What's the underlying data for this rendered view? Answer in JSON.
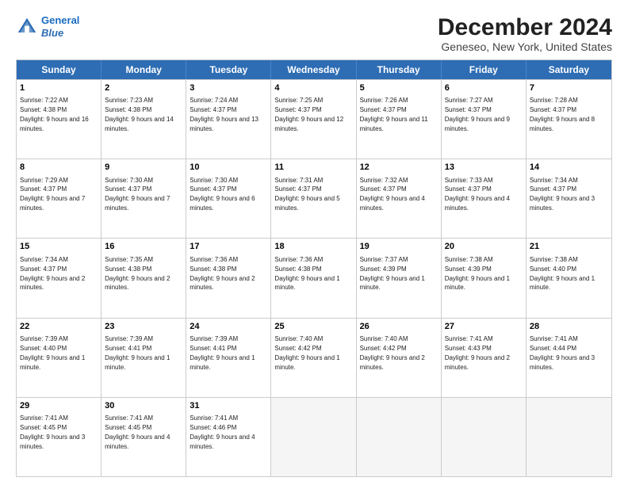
{
  "header": {
    "logo_line1": "General",
    "logo_line2": "Blue",
    "title": "December 2024",
    "subtitle": "Geneseo, New York, United States"
  },
  "weekdays": [
    "Sunday",
    "Monday",
    "Tuesday",
    "Wednesday",
    "Thursday",
    "Friday",
    "Saturday"
  ],
  "weeks": [
    [
      {
        "day": "1",
        "text": "Sunrise: 7:22 AM\nSunset: 4:38 PM\nDaylight: 9 hours and 16 minutes."
      },
      {
        "day": "2",
        "text": "Sunrise: 7:23 AM\nSunset: 4:38 PM\nDaylight: 9 hours and 14 minutes."
      },
      {
        "day": "3",
        "text": "Sunrise: 7:24 AM\nSunset: 4:37 PM\nDaylight: 9 hours and 13 minutes."
      },
      {
        "day": "4",
        "text": "Sunrise: 7:25 AM\nSunset: 4:37 PM\nDaylight: 9 hours and 12 minutes."
      },
      {
        "day": "5",
        "text": "Sunrise: 7:26 AM\nSunset: 4:37 PM\nDaylight: 9 hours and 11 minutes."
      },
      {
        "day": "6",
        "text": "Sunrise: 7:27 AM\nSunset: 4:37 PM\nDaylight: 9 hours and 9 minutes."
      },
      {
        "day": "7",
        "text": "Sunrise: 7:28 AM\nSunset: 4:37 PM\nDaylight: 9 hours and 8 minutes."
      }
    ],
    [
      {
        "day": "8",
        "text": "Sunrise: 7:29 AM\nSunset: 4:37 PM\nDaylight: 9 hours and 7 minutes."
      },
      {
        "day": "9",
        "text": "Sunrise: 7:30 AM\nSunset: 4:37 PM\nDaylight: 9 hours and 7 minutes."
      },
      {
        "day": "10",
        "text": "Sunrise: 7:30 AM\nSunset: 4:37 PM\nDaylight: 9 hours and 6 minutes."
      },
      {
        "day": "11",
        "text": "Sunrise: 7:31 AM\nSunset: 4:37 PM\nDaylight: 9 hours and 5 minutes."
      },
      {
        "day": "12",
        "text": "Sunrise: 7:32 AM\nSunset: 4:37 PM\nDaylight: 9 hours and 4 minutes."
      },
      {
        "day": "13",
        "text": "Sunrise: 7:33 AM\nSunset: 4:37 PM\nDaylight: 9 hours and 4 minutes."
      },
      {
        "day": "14",
        "text": "Sunrise: 7:34 AM\nSunset: 4:37 PM\nDaylight: 9 hours and 3 minutes."
      }
    ],
    [
      {
        "day": "15",
        "text": "Sunrise: 7:34 AM\nSunset: 4:37 PM\nDaylight: 9 hours and 2 minutes."
      },
      {
        "day": "16",
        "text": "Sunrise: 7:35 AM\nSunset: 4:38 PM\nDaylight: 9 hours and 2 minutes."
      },
      {
        "day": "17",
        "text": "Sunrise: 7:36 AM\nSunset: 4:38 PM\nDaylight: 9 hours and 2 minutes."
      },
      {
        "day": "18",
        "text": "Sunrise: 7:36 AM\nSunset: 4:38 PM\nDaylight: 9 hours and 1 minute."
      },
      {
        "day": "19",
        "text": "Sunrise: 7:37 AM\nSunset: 4:39 PM\nDaylight: 9 hours and 1 minute."
      },
      {
        "day": "20",
        "text": "Sunrise: 7:38 AM\nSunset: 4:39 PM\nDaylight: 9 hours and 1 minute."
      },
      {
        "day": "21",
        "text": "Sunrise: 7:38 AM\nSunset: 4:40 PM\nDaylight: 9 hours and 1 minute."
      }
    ],
    [
      {
        "day": "22",
        "text": "Sunrise: 7:39 AM\nSunset: 4:40 PM\nDaylight: 9 hours and 1 minute."
      },
      {
        "day": "23",
        "text": "Sunrise: 7:39 AM\nSunset: 4:41 PM\nDaylight: 9 hours and 1 minute."
      },
      {
        "day": "24",
        "text": "Sunrise: 7:39 AM\nSunset: 4:41 PM\nDaylight: 9 hours and 1 minute."
      },
      {
        "day": "25",
        "text": "Sunrise: 7:40 AM\nSunset: 4:42 PM\nDaylight: 9 hours and 1 minute."
      },
      {
        "day": "26",
        "text": "Sunrise: 7:40 AM\nSunset: 4:42 PM\nDaylight: 9 hours and 2 minutes."
      },
      {
        "day": "27",
        "text": "Sunrise: 7:41 AM\nSunset: 4:43 PM\nDaylight: 9 hours and 2 minutes."
      },
      {
        "day": "28",
        "text": "Sunrise: 7:41 AM\nSunset: 4:44 PM\nDaylight: 9 hours and 3 minutes."
      }
    ],
    [
      {
        "day": "29",
        "text": "Sunrise: 7:41 AM\nSunset: 4:45 PM\nDaylight: 9 hours and 3 minutes."
      },
      {
        "day": "30",
        "text": "Sunrise: 7:41 AM\nSunset: 4:45 PM\nDaylight: 9 hours and 4 minutes."
      },
      {
        "day": "31",
        "text": "Sunrise: 7:41 AM\nSunset: 4:46 PM\nDaylight: 9 hours and 4 minutes."
      },
      {
        "day": "",
        "text": ""
      },
      {
        "day": "",
        "text": ""
      },
      {
        "day": "",
        "text": ""
      },
      {
        "day": "",
        "text": ""
      }
    ]
  ]
}
